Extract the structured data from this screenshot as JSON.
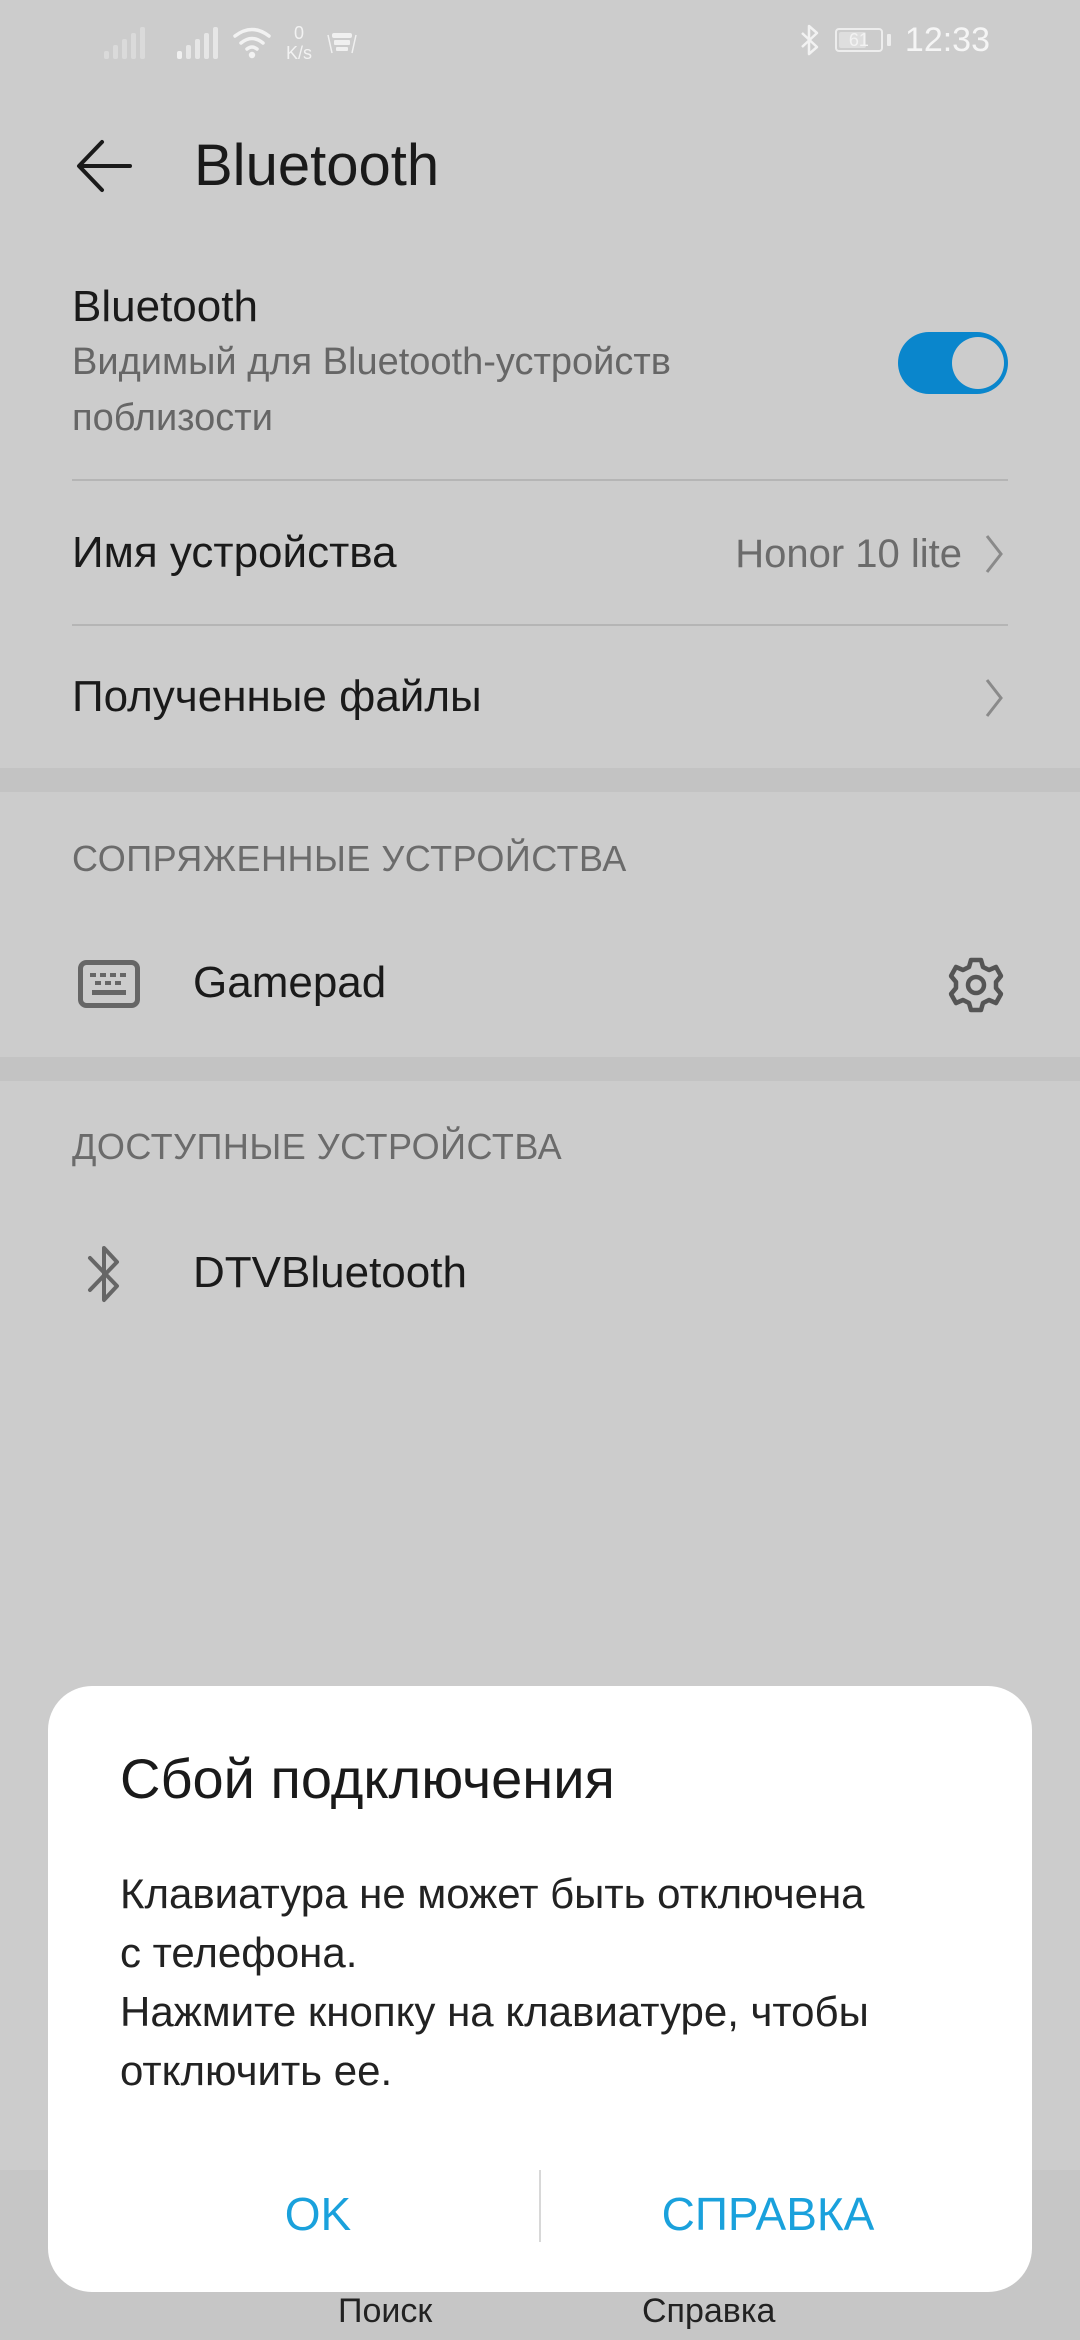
{
  "status_bar": {
    "net_speed_value": "0",
    "net_speed_unit": "K/s",
    "battery_level": "61",
    "time": "12:33",
    "icons": [
      "signal-sim1-icon",
      "signal-sim2-icon",
      "wifi-icon",
      "net-speed",
      "notification-icon",
      "bluetooth-icon",
      "battery-icon"
    ]
  },
  "app_bar": {
    "back_icon": "arrow-left-icon",
    "title": "Bluetooth"
  },
  "settings": {
    "bluetooth_toggle": {
      "title": "Bluetooth",
      "subtitle": "Видимый для Bluetooth-устройств поблизости",
      "state": "on",
      "accent_color": "#0a86cc"
    },
    "device_name": {
      "label": "Имя устройства",
      "value": "Honor 10 lite"
    },
    "received_files": {
      "label": "Полученные файлы"
    }
  },
  "paired_devices": {
    "header": "СОПРЯЖЕННЫЕ УСТРОЙСТВА",
    "items": [
      {
        "name": "Gamepad",
        "icon": "keyboard-icon",
        "action_icon": "gear-icon"
      }
    ]
  },
  "available_devices": {
    "header": "ДОСТУПНЫЕ УСТРОЙСТВА",
    "items": [
      {
        "name": "DTVBluetooth",
        "icon": "bluetooth-icon"
      }
    ]
  },
  "bottom_bar": {
    "search_label": "Поиск",
    "help_label": "Справка"
  },
  "dialog": {
    "title": "Сбой подключения",
    "message": "Клавиатура не может быть отключена\nс телефона.\nНажмите кнопку на клавиатуре, чтобы\nотключить ее.",
    "ok_label": "OK",
    "help_label": "СПРАВКА",
    "button_color": "#1aa1dc"
  }
}
